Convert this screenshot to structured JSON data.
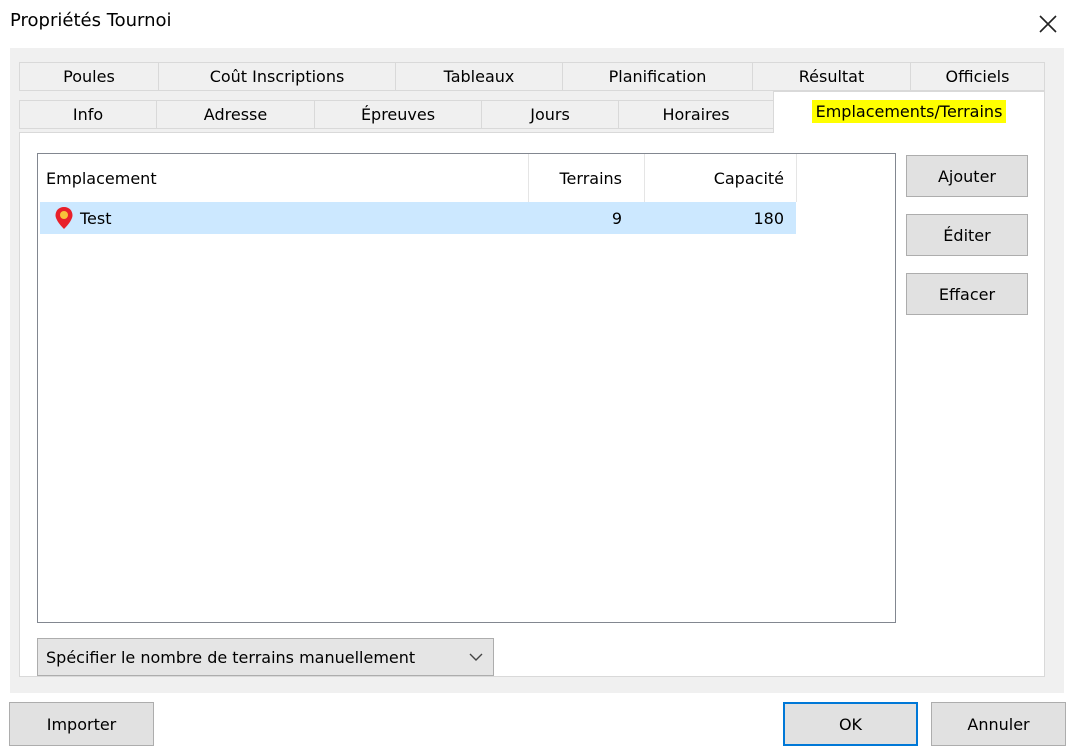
{
  "window": {
    "title": "Propriétés Tournoi"
  },
  "tabs_row1": [
    {
      "label": "Poules"
    },
    {
      "label": "Coût Inscriptions"
    },
    {
      "label": "Tableaux"
    },
    {
      "label": "Planification"
    },
    {
      "label": "Résultat"
    },
    {
      "label": "Officiels"
    }
  ],
  "tabs_row2": [
    {
      "label": "Info"
    },
    {
      "label": "Adresse"
    },
    {
      "label": "Épreuves"
    },
    {
      "label": "Jours"
    },
    {
      "label": "Horaires"
    },
    {
      "label": "Emplacements/Terrains",
      "active": true
    }
  ],
  "list": {
    "columns": [
      "Emplacement",
      "Terrains",
      "Capacité"
    ],
    "rows": [
      {
        "name": "Test",
        "terrains": "9",
        "capacite": "180",
        "icon": "map-pin-icon",
        "selected": true
      }
    ]
  },
  "side_buttons": {
    "add": "Ajouter",
    "edit": "Éditer",
    "delete": "Effacer"
  },
  "mode_select": {
    "value": "Spécifier le nombre de terrains manuellement"
  },
  "footer": {
    "import": "Importer",
    "ok": "OK",
    "cancel": "Annuler"
  },
  "colors": {
    "highlight": "#ffff00",
    "selection": "#cce8ff",
    "accent": "#0078d7",
    "pin": "#e8202a"
  }
}
